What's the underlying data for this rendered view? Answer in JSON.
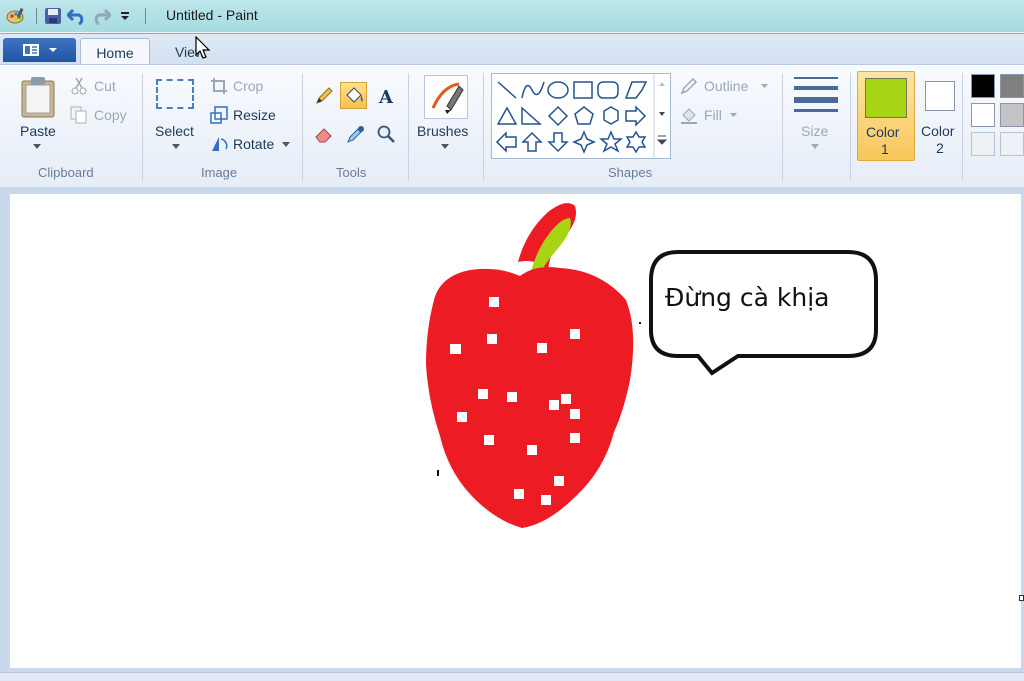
{
  "window": {
    "title": "Untitled - Paint"
  },
  "tabs": [
    {
      "label": "Home"
    },
    {
      "label": "View"
    }
  ],
  "clipboard": {
    "paste": "Paste",
    "cut": "Cut",
    "copy": "Copy",
    "group": "Clipboard"
  },
  "image": {
    "select": "Select",
    "crop": "Crop",
    "resize": "Resize",
    "rotate": "Rotate",
    "group": "Image"
  },
  "tools": {
    "group": "Tools",
    "selected_tool": "fill-icon"
  },
  "brushes": {
    "label": "Brushes"
  },
  "shapes": {
    "outline": "Outline",
    "fill": "Fill",
    "group": "Shapes"
  },
  "size": {
    "label": "Size"
  },
  "colors": {
    "color1_label": "Color",
    "color1_num": "1",
    "color1_value": "#a8d416",
    "color2_label": "Color",
    "color2_num": "2",
    "color2_value": "#ffffff",
    "palette": [
      "#000000",
      "#7f7f7f",
      "#ffffff",
      "#c3c3c3"
    ]
  },
  "canvas": {
    "speech_text": "Đừng cà khịa",
    "strawberry_color": "#ed1c24",
    "leaf_color": "#a8d416"
  }
}
